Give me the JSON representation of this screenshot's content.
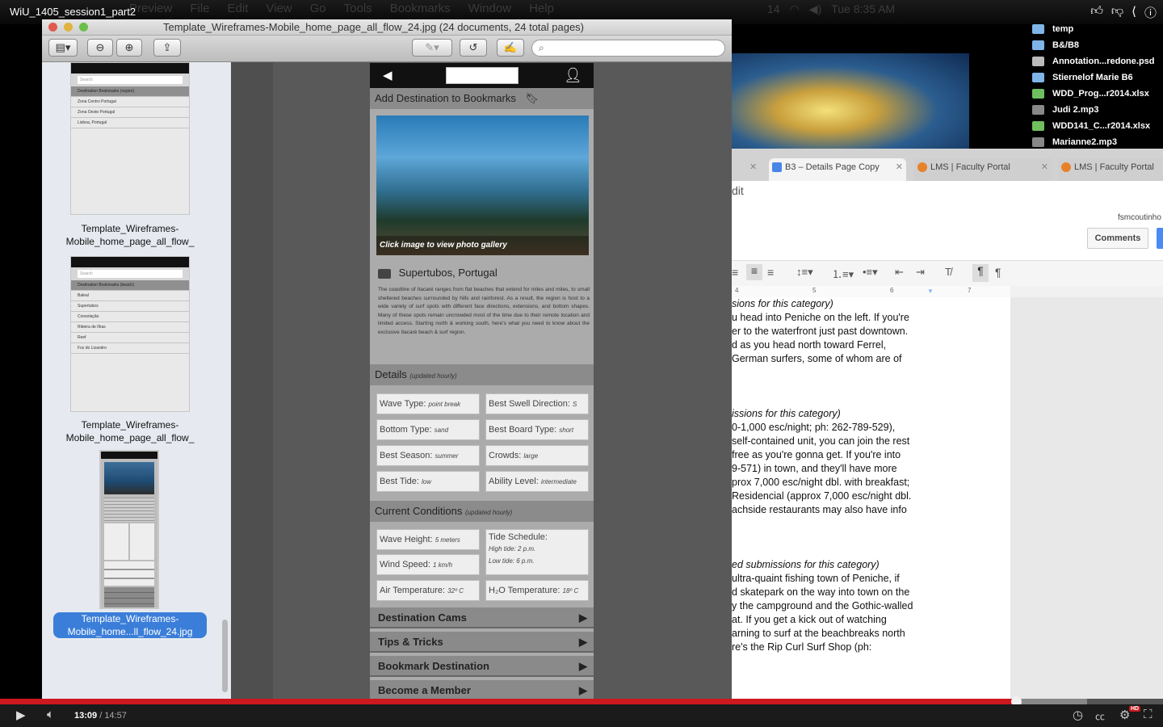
{
  "video": {
    "title": "WiU_1405_session1_part2",
    "current_time": "13:09",
    "duration": "14:57",
    "progress": 0.874,
    "hd_badge": "HD"
  },
  "mac_menu": [
    "Preview",
    "File",
    "Edit",
    "View",
    "Go",
    "Tools",
    "Bookmarks",
    "Window",
    "Help"
  ],
  "mac_status": {
    "clock": "Tue 8:35 AM",
    "input_badge": "14"
  },
  "desktop_files": [
    {
      "name": "temp",
      "kind": "folder"
    },
    {
      "name": "B&/B8",
      "kind": "folder"
    },
    {
      "name": "Annotation...redone.psd",
      "kind": "doc"
    },
    {
      "name": "Stiernelof Marie B6",
      "kind": "folder"
    },
    {
      "name": "WDD_Prog...r2014.xlsx",
      "kind": "xls"
    },
    {
      "name": "Judi 2.mp3",
      "kind": "mp3"
    },
    {
      "name": "WDD141_C...r2014.xlsx",
      "kind": "xls"
    },
    {
      "name": "Marianne2.mp3",
      "kind": "mp3"
    }
  ],
  "preview": {
    "window_title": "Template_Wireframes-Mobile_home_page_all_flow_24.jpg (24 documents, 24 total pages)",
    "search_placeholder": "",
    "thumbnails": [
      {
        "label": "Template_Wireframes-\nMobile_home_page_all_flow_",
        "header": "Destination Bookmarks (region)",
        "rows": [
          "Zona Centro Portugal",
          "Zona Oeste Portugal",
          "Lisboa, Portugal"
        ],
        "search": "Search"
      },
      {
        "label": "Template_Wireframes-\nMobile_home_page_all_flow_",
        "header": "Destination Bookmarks (beach)",
        "rows": [
          "Baleal",
          "Supertubos",
          "Consolação",
          "Ribeira de Ilhas",
          "Reef",
          "Foz do Lizandro"
        ],
        "search": "Search"
      },
      {
        "label": "Template_Wireframes-\nMobile_home...ll_flow_24.jpg",
        "selected": true
      }
    ],
    "page": {
      "add_bookmark": "Add Destination to Bookmarks",
      "photo_caption": "Click image to view photo gallery",
      "location": "Supertubos, Portugal",
      "description": "The coastline of Itacaré ranges from flat beaches that extend for miles and miles, to small sheltered beaches surrounded by hills and rainforest. As a result, the region is host to a wide variety of surf spots with different face directions, extensions, and bottom shapes. Many of these spots remain uncrowded most of the time due to their remote location and limited access. Starting north & working south, here's what you need to know about the exclusive Itacaré beach & surf region.",
      "details_title": "Details",
      "details_note": "(updated hourly)",
      "details": [
        {
          "label": "Wave Type:",
          "value": "point break"
        },
        {
          "label": "Best Swell Direction:",
          "value": "S"
        },
        {
          "label": "Bottom Type:",
          "value": "sand"
        },
        {
          "label": "Best Board Type:",
          "value": "short"
        },
        {
          "label": "Best Season:",
          "value": "summer"
        },
        {
          "label": "Crowds:",
          "value": "large"
        },
        {
          "label": "Best Tide:",
          "value": "low"
        },
        {
          "label": "Ability Level:",
          "value": "intermediate"
        }
      ],
      "conditions_title": "Current Conditions",
      "conditions_note": "(updated hourly)",
      "conditions": {
        "wave_height": {
          "label": "Wave Height:",
          "value": "5 meters"
        },
        "wind_speed": {
          "label": "Wind Speed:",
          "value": "1 km/h"
        },
        "air_temp": {
          "label": "Air Temperature:",
          "value": "32º C"
        },
        "tide_label": "Tide Schedule:",
        "high_tide": "High tide: 2 p.m.",
        "low_tide": "Low tide: 6 p.m.",
        "water_temp": {
          "label": "H₂O Temperature:",
          "value": "18º C"
        }
      },
      "nav": [
        "Destination Cams",
        "Tips & Tricks",
        "Bookmark Destination",
        "Become a Member"
      ]
    }
  },
  "browser": {
    "tabs": [
      {
        "label": "B3 – Details Page Copy",
        "active": true
      },
      {
        "label": "LMS | Faculty Portal",
        "active": false
      },
      {
        "label": "LMS | Faculty Portal",
        "active": false
      }
    ],
    "menu_fragment": "dit",
    "user": "fsmcoutinho",
    "comments_button": "Comments",
    "ruler": [
      "4",
      "5",
      "6",
      "7"
    ],
    "doc_lines": [
      "sions for this category)",
      "u head into Peniche on the left. If you're",
      "er to the waterfront just past downtown.",
      "d as you head north toward Ferrel,",
      " German surfers, some of whom are of",
      "",
      "",
      "",
      "issions for this category)",
      "0-1,000 esc/night; ph: 262-789-529),",
      "self-contained unit, you can join the rest",
      " free as you're gonna get. If you're into",
      "9-571) in town, and they'll have more",
      "prox 7,000 esc/night dbl. with breakfast;",
      "Residencial (approx 7,000 esc/night dbl.",
      "achside restaurants may also have info",
      "",
      "",
      "",
      "ed submissions for this category)",
      " ultra-quaint fishing town of Peniche, if",
      "d skatepark on the way into town on the",
      "y the campground and the Gothic-walled",
      "at. If you get a kick out of watching",
      "arning to surf at the beachbreaks north",
      "re's the Rip Curl Surf Shop (ph:"
    ]
  }
}
